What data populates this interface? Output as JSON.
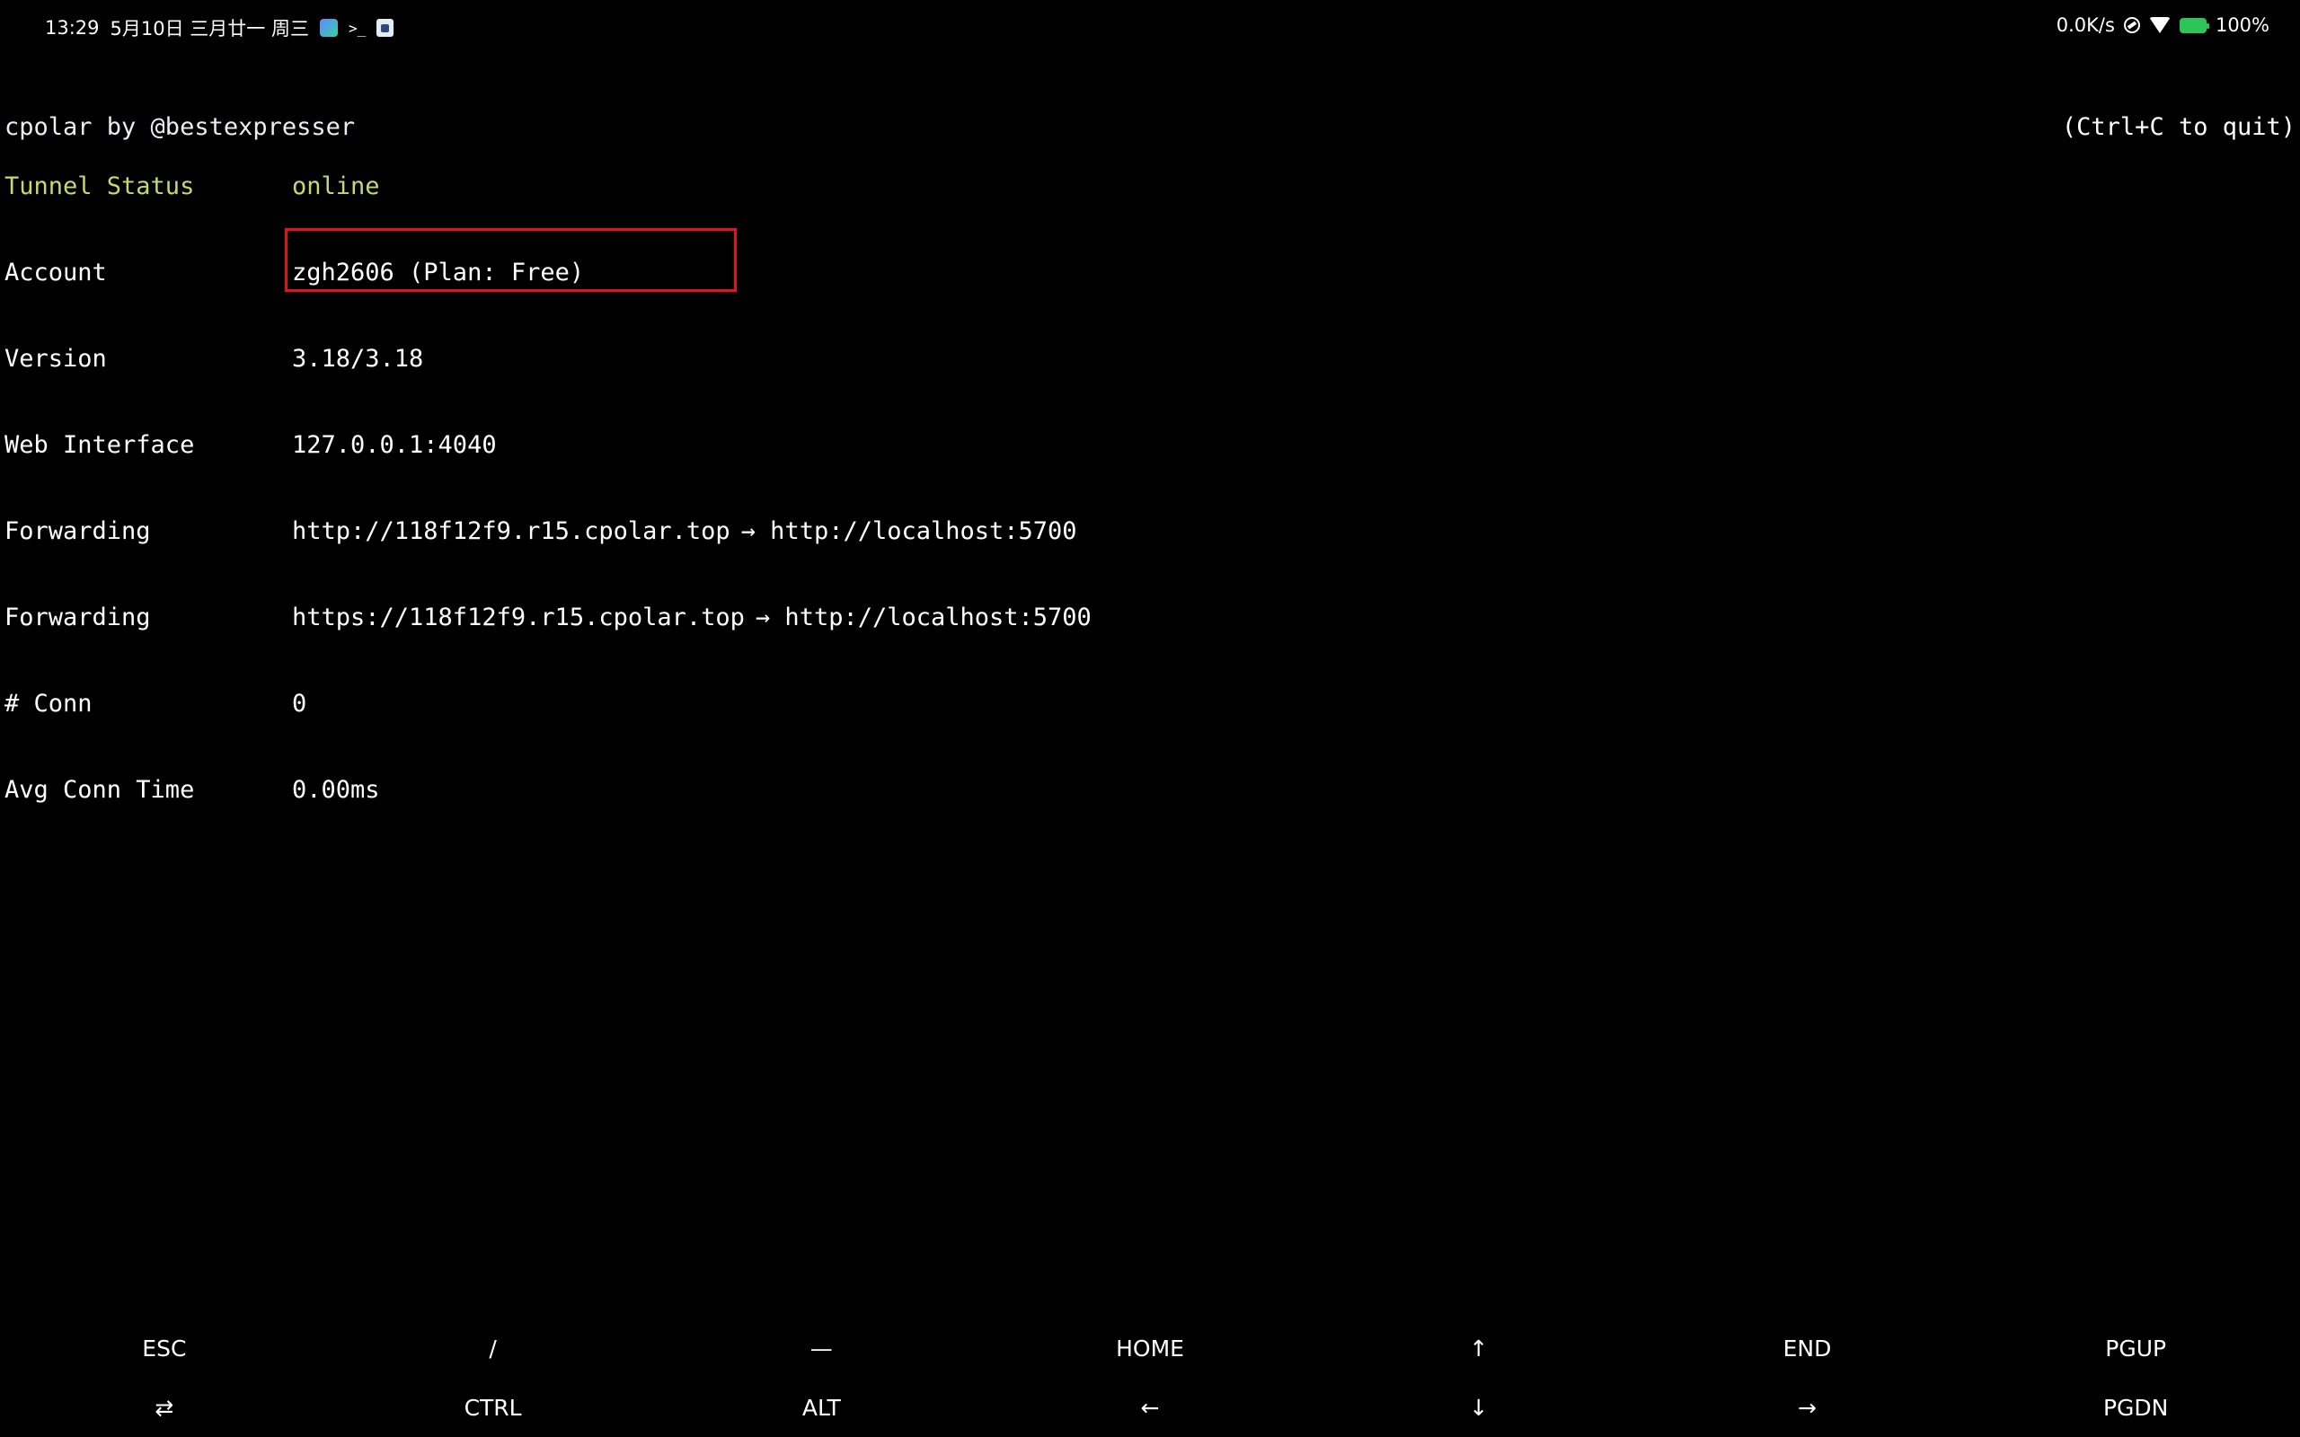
{
  "status_bar": {
    "time": "13:29",
    "date": "5月10日 三月廿一 周三",
    "icons_left": [
      "app-icon",
      "terminal-icon",
      "app-icon-square"
    ],
    "net_speed": "0.0K/s",
    "battery": "100%",
    "colors": {
      "battery": "#2ec45a"
    }
  },
  "terminal": {
    "title": "cpolar by @bestexpresser",
    "quit_hint": "(Ctrl+C to quit)",
    "rows": [
      {
        "label": "Tunnel Status",
        "value": "online"
      },
      {
        "label": "Account",
        "value": "zgh2606 (Plan: Free)"
      },
      {
        "label": "Version",
        "value": "3.18/3.18"
      },
      {
        "label": "Web Interface",
        "value": "127.0.0.1:4040"
      },
      {
        "label": "Forwarding",
        "url": "http://118f12f9.r15.cpolar.top",
        "target": "→ http://localhost:5700"
      },
      {
        "label": "Forwarding",
        "url": "https://118f12f9.r15.cpolar.top",
        "target": "→ http://localhost:5700"
      },
      {
        "label": "# Conn",
        "value": "0"
      },
      {
        "label": "Avg Conn Time",
        "value": "0.00ms"
      }
    ],
    "colors": {
      "status": "#c8d96b",
      "highlight": "#e0141c",
      "background": "#000000"
    }
  },
  "extra_keys": {
    "row1": [
      "ESC",
      "/",
      "—",
      "HOME",
      "↑",
      "END",
      "PGUP"
    ],
    "row2": [
      "⇄",
      "CTRL",
      "ALT",
      "←",
      "↓",
      "→",
      "PGDN"
    ]
  }
}
